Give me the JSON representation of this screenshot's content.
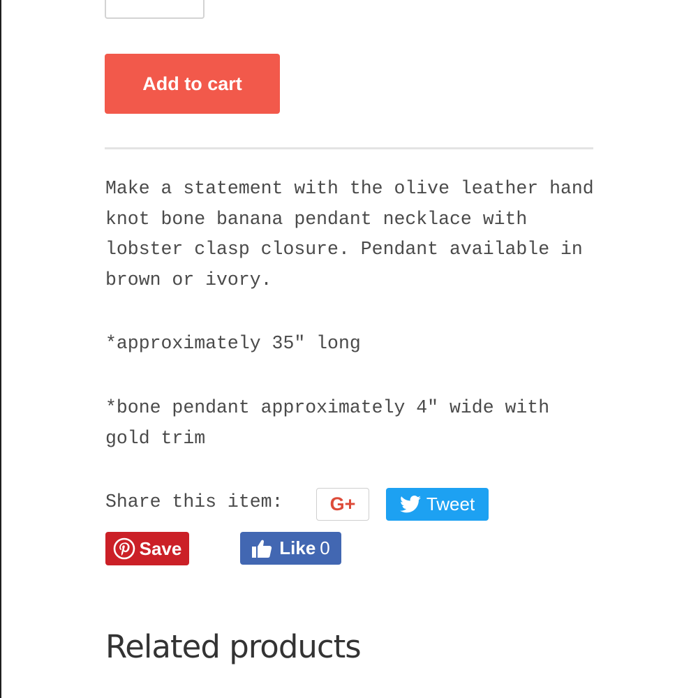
{
  "product": {
    "quantity_value": "",
    "add_to_cart_label": "Add to cart"
  },
  "description": {
    "main": "Make a statement with the olive leather hand knot bone banana pendant necklace with lobster clasp closure. Pendant available in brown or ivory.",
    "length_note": "*approximately 35\" long",
    "pendant_note": "*bone pendant approximately 4\" wide with gold trim"
  },
  "share": {
    "label": "Share this item:",
    "google_plus_label": "G+",
    "tweet_label": "Tweet",
    "pinterest_label": "Save",
    "facebook_label": "Like",
    "facebook_count": "0"
  },
  "related": {
    "title": "Related products"
  },
  "colors": {
    "add_to_cart": "#f2594b",
    "google_plus": "#dd4b39",
    "twitter": "#1da1f2",
    "pinterest": "#cb2027",
    "facebook": "#4267b2",
    "body_text": "#4a4a4a"
  },
  "icons": {
    "twitter": "twitter-bird-icon",
    "pinterest": "pinterest-icon",
    "facebook": "thumbs-up-icon"
  }
}
